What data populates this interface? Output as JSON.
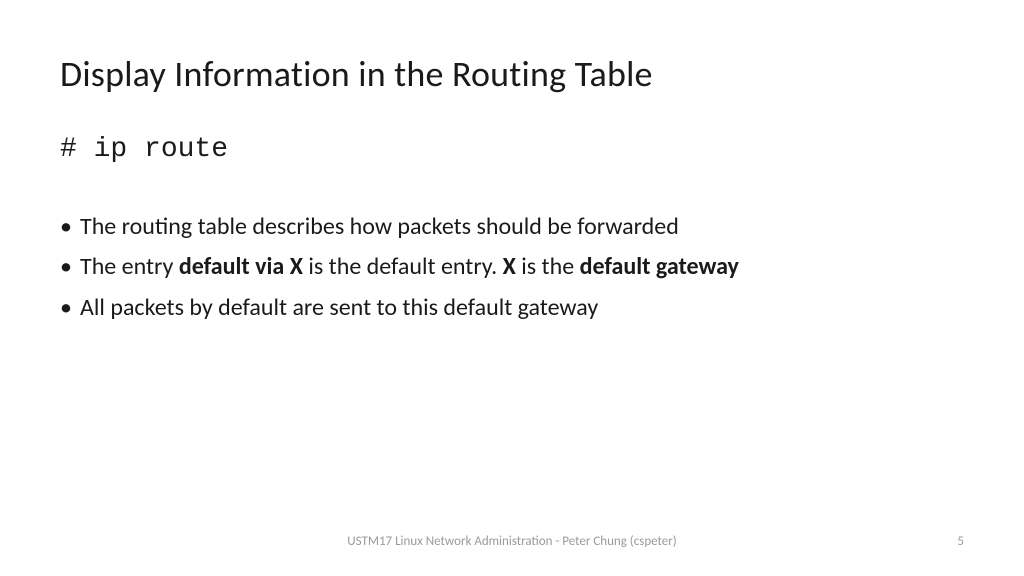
{
  "title": "Display Information in the Routing Table",
  "command": "# ip route",
  "bullets": [
    {
      "parts": [
        {
          "t": "The routing table describes how packets should be forwarded",
          "b": false
        }
      ]
    },
    {
      "parts": [
        {
          "t": "The entry ",
          "b": false
        },
        {
          "t": "default via X",
          "b": true
        },
        {
          "t": " is the default entry. ",
          "b": false
        },
        {
          "t": "X",
          "b": true
        },
        {
          "t": " is the ",
          "b": false
        },
        {
          "t": "default gateway",
          "b": true
        }
      ]
    },
    {
      "parts": [
        {
          "t": "All packets by default are sent to this default gateway",
          "b": false
        }
      ]
    }
  ],
  "footer": {
    "center": "USTM17 Linux Network Administration - Peter Chung (cspeter)",
    "page": "5"
  }
}
